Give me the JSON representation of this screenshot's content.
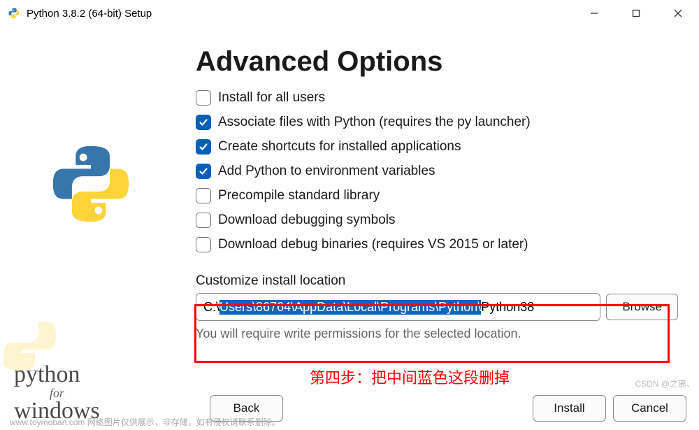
{
  "window": {
    "title": "Python 3.8.2 (64-bit) Setup"
  },
  "main": {
    "heading": "Advanced Options",
    "options": [
      {
        "label": "Install for all users",
        "checked": false
      },
      {
        "label": "Associate files with Python (requires the py launcher)",
        "checked": true
      },
      {
        "label": "Create shortcuts for installed applications",
        "checked": true
      },
      {
        "label": "Add Python to environment variables",
        "checked": true
      },
      {
        "label": "Precompile standard library",
        "checked": false
      },
      {
        "label": "Download debugging symbols",
        "checked": false
      },
      {
        "label": "Download debug binaries (requires VS 2015 or later)",
        "checked": false
      }
    ],
    "customize_label": "Customize install location",
    "path": {
      "prefix": "C:\\",
      "selected": "Users\\86764\\AppData\\Local\\Programs\\Python\\",
      "suffix": "Python38"
    },
    "browse_label": "Browse",
    "permission_note": "You will require write permissions for the selected location."
  },
  "buttons": {
    "back": "Back",
    "install": "Install",
    "cancel": "Cancel"
  },
  "brand": {
    "py": "python",
    "for": "for",
    "win": "windows"
  },
  "annotation": {
    "step4": "第四步：把中间蓝色这段删掉"
  },
  "watermark": {
    "bottom": "www.toymoban.com  网络图片仅供展示，非存储，如有侵权请联系删除。",
    "right": "CSDN @之离、"
  }
}
